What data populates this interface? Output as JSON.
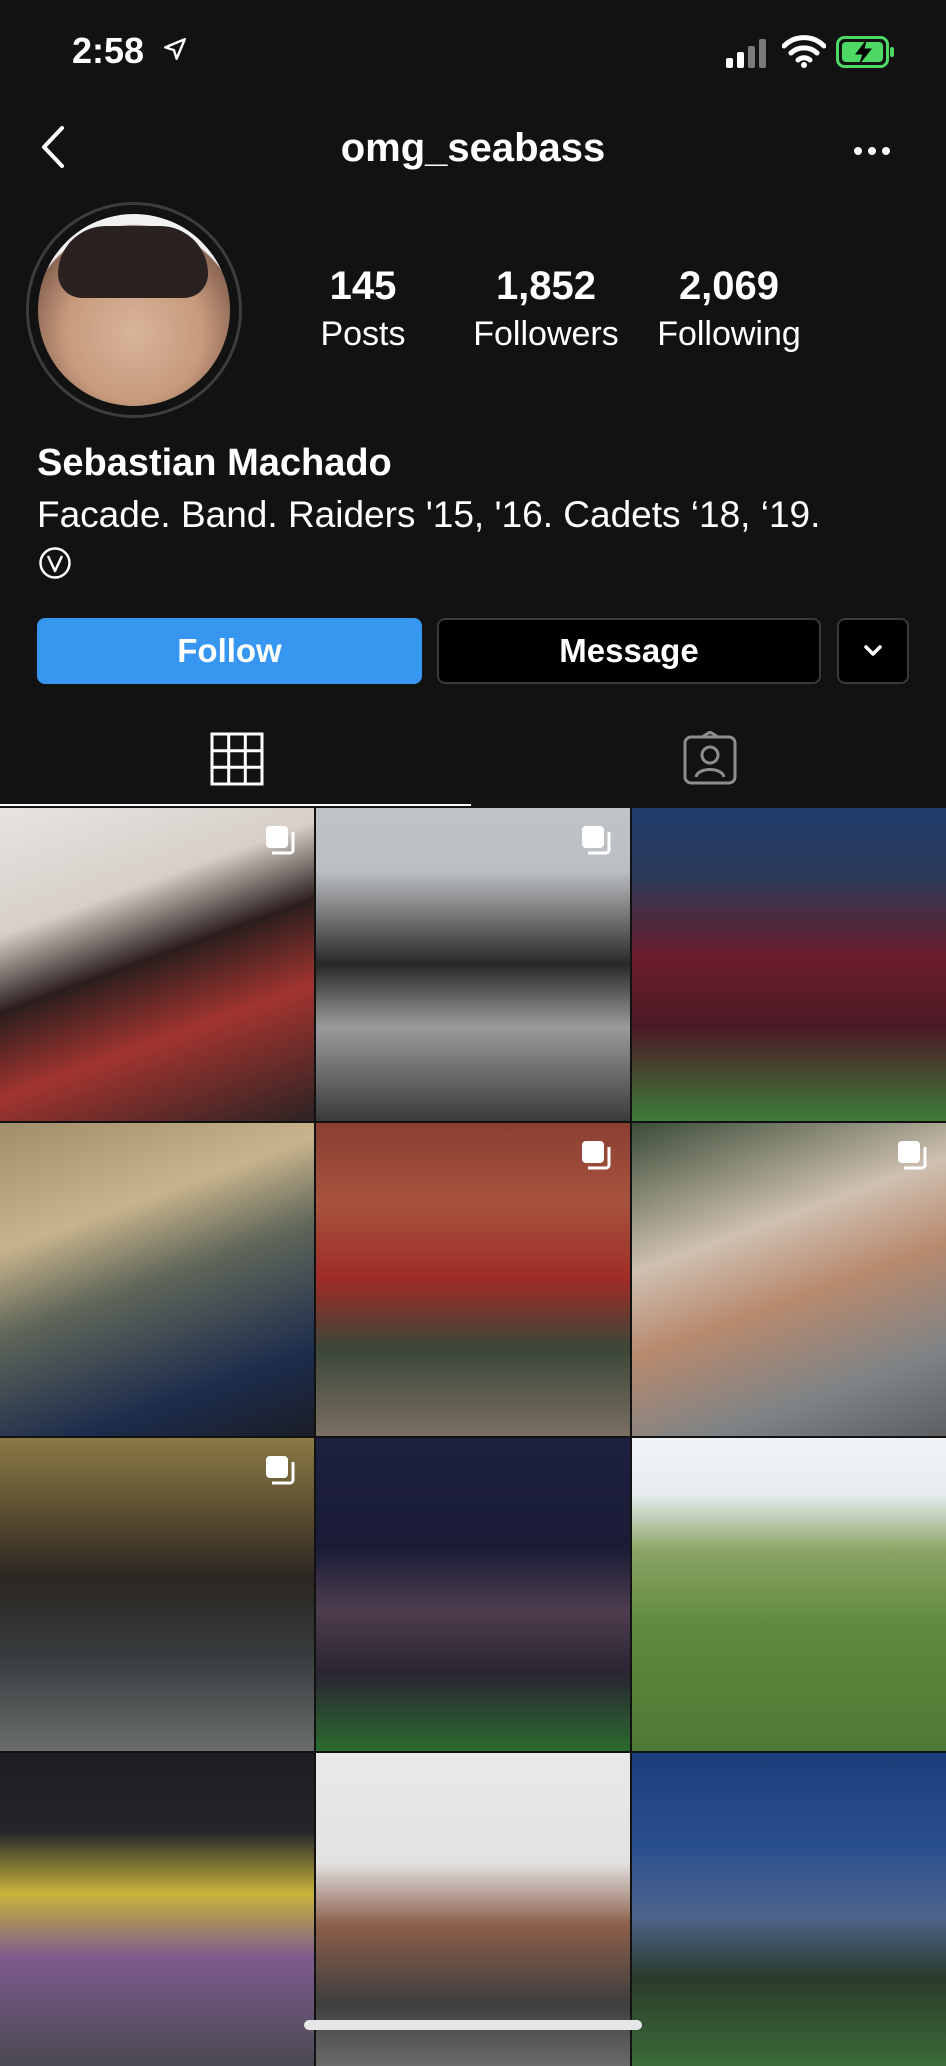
{
  "status_bar": {
    "time": "2:58"
  },
  "header": {
    "username": "omg_seabass"
  },
  "profile": {
    "full_name": "Sebastian Machado",
    "bio": "Facade. Band. Raiders '15, '16. Cadets ‘18, ‘19.",
    "stats": [
      {
        "value": "145",
        "label": "Posts"
      },
      {
        "value": "1,852",
        "label": "Followers"
      },
      {
        "value": "2,069",
        "label": "Following"
      }
    ]
  },
  "actions": {
    "follow_label": "Follow",
    "message_label": "Message"
  },
  "tabs": [
    {
      "icon": "grid-icon",
      "active": true
    },
    {
      "icon": "tagged-icon",
      "active": false
    }
  ],
  "colors": {
    "background": "#121212",
    "accent": "#3797f0",
    "text": "#ffffff"
  },
  "posts": [
    {
      "multi": true
    },
    {
      "multi": true
    },
    {
      "multi": false
    },
    {
      "multi": false
    },
    {
      "multi": true
    },
    {
      "multi": true
    },
    {
      "multi": true
    },
    {
      "multi": false
    },
    {
      "multi": false
    },
    {
      "multi": false
    },
    {
      "multi": false
    },
    {
      "multi": false
    }
  ]
}
